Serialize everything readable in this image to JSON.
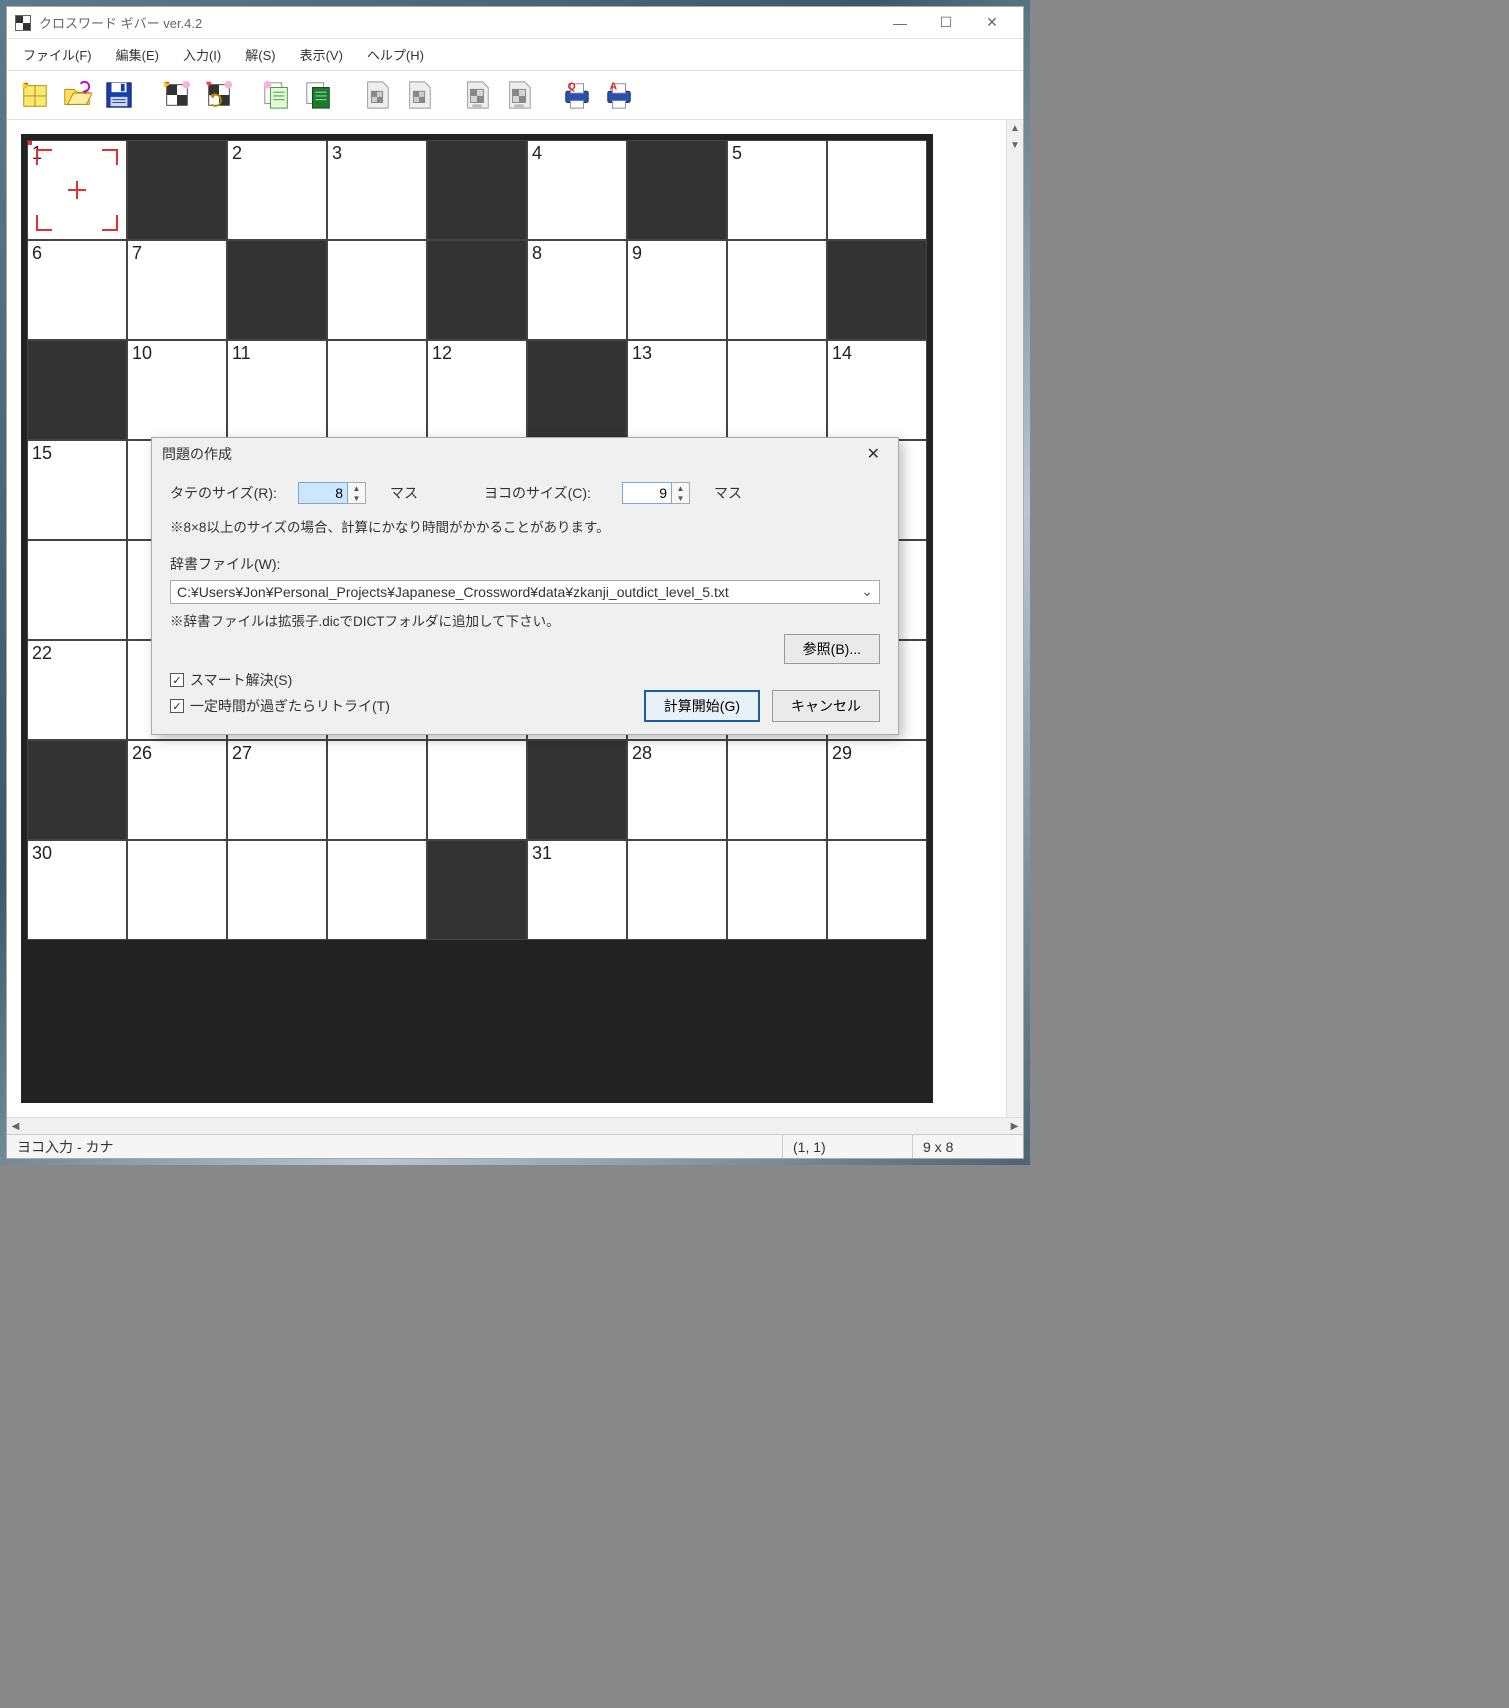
{
  "window": {
    "title": "クロスワード ギバー ver.4.2"
  },
  "menu": {
    "file": "ファイル(F)",
    "edit": "編集(E)",
    "input": "入力(I)",
    "solve": "解(S)",
    "view": "表示(V)",
    "help": "ヘルプ(H)"
  },
  "toolbar": {
    "new": "新規",
    "open": "開く",
    "save": "保存",
    "new_q": "新問",
    "new_q2": "再問",
    "copy": "コピー",
    "copy2": "コピー2",
    "img1": "画像1",
    "img2": "画像2",
    "img3": "画像3",
    "img4": "画像4",
    "print_q": "Q印刷",
    "print_a": "A印刷"
  },
  "grid": {
    "cols": 9,
    "rows": 8,
    "cells": [
      {
        "r": 0,
        "c": 0,
        "n": "1",
        "cursor": true
      },
      {
        "r": 0,
        "c": 1,
        "black": true
      },
      {
        "r": 0,
        "c": 2,
        "n": "2"
      },
      {
        "r": 0,
        "c": 3,
        "n": "3"
      },
      {
        "r": 0,
        "c": 4,
        "black": true
      },
      {
        "r": 0,
        "c": 5,
        "n": "4"
      },
      {
        "r": 0,
        "c": 6,
        "black": true
      },
      {
        "r": 0,
        "c": 7,
        "n": "5"
      },
      {
        "r": 0,
        "c": 8
      },
      {
        "r": 1,
        "c": 0,
        "n": "6"
      },
      {
        "r": 1,
        "c": 1,
        "n": "7"
      },
      {
        "r": 1,
        "c": 2,
        "black": true
      },
      {
        "r": 1,
        "c": 3
      },
      {
        "r": 1,
        "c": 4,
        "black": true
      },
      {
        "r": 1,
        "c": 5,
        "n": "8"
      },
      {
        "r": 1,
        "c": 6,
        "n": "9"
      },
      {
        "r": 1,
        "c": 7
      },
      {
        "r": 1,
        "c": 8,
        "black": true
      },
      {
        "r": 2,
        "c": 0,
        "black": true
      },
      {
        "r": 2,
        "c": 1,
        "n": "10"
      },
      {
        "r": 2,
        "c": 2,
        "n": "11"
      },
      {
        "r": 2,
        "c": 3
      },
      {
        "r": 2,
        "c": 4,
        "n": "12"
      },
      {
        "r": 2,
        "c": 5,
        "black": true
      },
      {
        "r": 2,
        "c": 6,
        "n": "13"
      },
      {
        "r": 2,
        "c": 7
      },
      {
        "r": 2,
        "c": 8,
        "n": "14"
      },
      {
        "r": 3,
        "c": 0,
        "n": "15"
      },
      {
        "r": 3,
        "c": 1
      },
      {
        "r": 3,
        "c": 2
      },
      {
        "r": 3,
        "c": 3
      },
      {
        "r": 3,
        "c": 4
      },
      {
        "r": 3,
        "c": 5
      },
      {
        "r": 3,
        "c": 6
      },
      {
        "r": 3,
        "c": 7
      },
      {
        "r": 3,
        "c": 8
      },
      {
        "r": 4,
        "c": 0
      },
      {
        "r": 4,
        "c": 1
      },
      {
        "r": 4,
        "c": 2
      },
      {
        "r": 4,
        "c": 3
      },
      {
        "r": 4,
        "c": 4
      },
      {
        "r": 4,
        "c": 5
      },
      {
        "r": 4,
        "c": 6
      },
      {
        "r": 4,
        "c": 7
      },
      {
        "r": 4,
        "c": 8
      },
      {
        "r": 5,
        "c": 0,
        "n": "22"
      },
      {
        "r": 5,
        "c": 1
      },
      {
        "r": 5,
        "c": 2
      },
      {
        "r": 5,
        "c": 3
      },
      {
        "r": 5,
        "c": 4
      },
      {
        "r": 5,
        "c": 5
      },
      {
        "r": 5,
        "c": 6
      },
      {
        "r": 5,
        "c": 7
      },
      {
        "r": 5,
        "c": 8
      },
      {
        "r": 6,
        "c": 0,
        "black": true
      },
      {
        "r": 6,
        "c": 1,
        "n": "26"
      },
      {
        "r": 6,
        "c": 2,
        "n": "27"
      },
      {
        "r": 6,
        "c": 3
      },
      {
        "r": 6,
        "c": 4
      },
      {
        "r": 6,
        "c": 5,
        "black": true
      },
      {
        "r": 6,
        "c": 6,
        "n": "28"
      },
      {
        "r": 6,
        "c": 7
      },
      {
        "r": 6,
        "c": 8,
        "n": "29"
      },
      {
        "r": 7,
        "c": 0,
        "n": "30"
      },
      {
        "r": 7,
        "c": 1
      },
      {
        "r": 7,
        "c": 2
      },
      {
        "r": 7,
        "c": 3
      },
      {
        "r": 7,
        "c": 4,
        "black": true
      },
      {
        "r": 7,
        "c": 5,
        "n": "31"
      },
      {
        "r": 7,
        "c": 6
      },
      {
        "r": 7,
        "c": 7
      },
      {
        "r": 7,
        "c": 8
      }
    ]
  },
  "dialog": {
    "title": "問題の作成",
    "rows_label": "タテのサイズ(R):",
    "rows_value": "8",
    "cols_label": "ヨコのサイズ(C):",
    "cols_value": "9",
    "unit": "マス",
    "size_note": "※8×8以上のサイズの場合、計算にかなり時間がかかることがあります。",
    "dict_label": "辞書ファイル(W):",
    "dict_path": "C:¥Users¥Jon¥Personal_Projects¥Japanese_Crossword¥data¥zkanji_outdict_level_5.txt",
    "dict_note": "※辞書ファイルは拡張子.dicでDICTフォルダに追加して下さい。",
    "browse": "参照(B)...",
    "smart": "スマート解決(S)",
    "retry": "一定時間が過ぎたらリトライ(T)",
    "start": "計算開始(G)",
    "cancel": "キャンセル"
  },
  "status": {
    "mode": "ヨコ入力 - カナ",
    "pos": "(1, 1)",
    "size": "9 x 8"
  }
}
